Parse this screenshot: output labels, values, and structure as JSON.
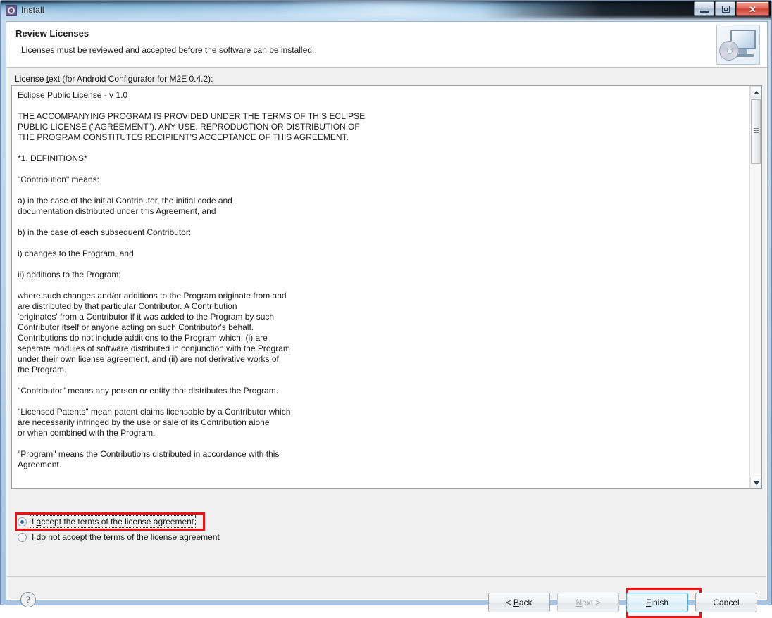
{
  "window": {
    "title": "Install",
    "icon": "install-gear-icon",
    "controls": {
      "minimize": "minimize-button",
      "maximize": "maximize-button",
      "close": "✕"
    }
  },
  "header": {
    "title": "Review Licenses",
    "subtitle": "Licenses must be reviewed and accepted before the software can be installed.",
    "icon": "monitor-disc-icon"
  },
  "license": {
    "label_prefix": "License ",
    "label_accesskey": "t",
    "label_suffix": "ext (for Android Configurator for M2E 0.4.2):",
    "label_full": "License text (for Android Configurator for M2E 0.4.2):",
    "text_lines": [
      "Eclipse Public License - v 1.0",
      "",
      "THE ACCOMPANYING PROGRAM IS PROVIDED UNDER THE TERMS OF THIS ECLIPSE",
      "PUBLIC LICENSE (\"AGREEMENT\"). ANY USE, REPRODUCTION OR DISTRIBUTION OF",
      "THE PROGRAM CONSTITUTES RECIPIENT'S ACCEPTANCE OF THIS AGREEMENT.",
      "",
      "*1. DEFINITIONS*",
      "",
      "\"Contribution\" means:",
      "",
      "a) in the case of the initial Contributor, the initial code and",
      "documentation distributed under this Agreement, and",
      "",
      "b) in the case of each subsequent Contributor:",
      "",
      "i) changes to the Program, and",
      "",
      "ii) additions to the Program;",
      "",
      "where such changes and/or additions to the Program originate from and",
      "are distributed by that particular Contributor. A Contribution",
      "'originates' from a Contributor if it was added to the Program by such",
      "Contributor itself or anyone acting on such Contributor's behalf.",
      "Contributions do not include additions to the Program which: (i) are",
      "separate modules of software distributed in conjunction with the Program",
      "under their own license agreement, and (ii) are not derivative works of",
      "the Program.",
      "",
      "\"Contributor\" means any person or entity that distributes the Program.",
      "",
      "\"Licensed Patents\" mean patent claims licensable by a Contributor which",
      "are necessarily infringed by the use or sale of its Contribution alone",
      "or when combined with the Program.",
      "",
      "\"Program\" means the Contributions distributed in accordance with this",
      "Agreement."
    ]
  },
  "radios": {
    "accept": {
      "label_full": "I accept the terms of the license agreement",
      "before": "I ",
      "accesskey": "a",
      "after": "ccept the terms of the license agreement",
      "selected": true
    },
    "decline": {
      "label_full": "I do not accept the terms of the license agreement",
      "before": "I ",
      "accesskey": "d",
      "after": "o not accept the terms of the license agreement",
      "selected": false
    }
  },
  "footer": {
    "help": "?",
    "buttons": {
      "back": {
        "before": "< ",
        "accesskey": "B",
        "after": "ack",
        "label_full": "< Back",
        "enabled": true
      },
      "next": {
        "before": "",
        "accesskey": "N",
        "after": "ext >",
        "label_full": "Next >",
        "enabled": false
      },
      "finish": {
        "before": "",
        "accesskey": "F",
        "after": "inish",
        "label_full": "Finish",
        "enabled": true,
        "default": true
      },
      "cancel": {
        "before": "",
        "accesskey": "",
        "after": "Cancel",
        "label_full": "Cancel",
        "enabled": true
      }
    }
  },
  "annotations": {
    "highlight_color": "#ee1111",
    "boxes": [
      "accept-radio-highlight",
      "finish-button-highlight"
    ]
  }
}
